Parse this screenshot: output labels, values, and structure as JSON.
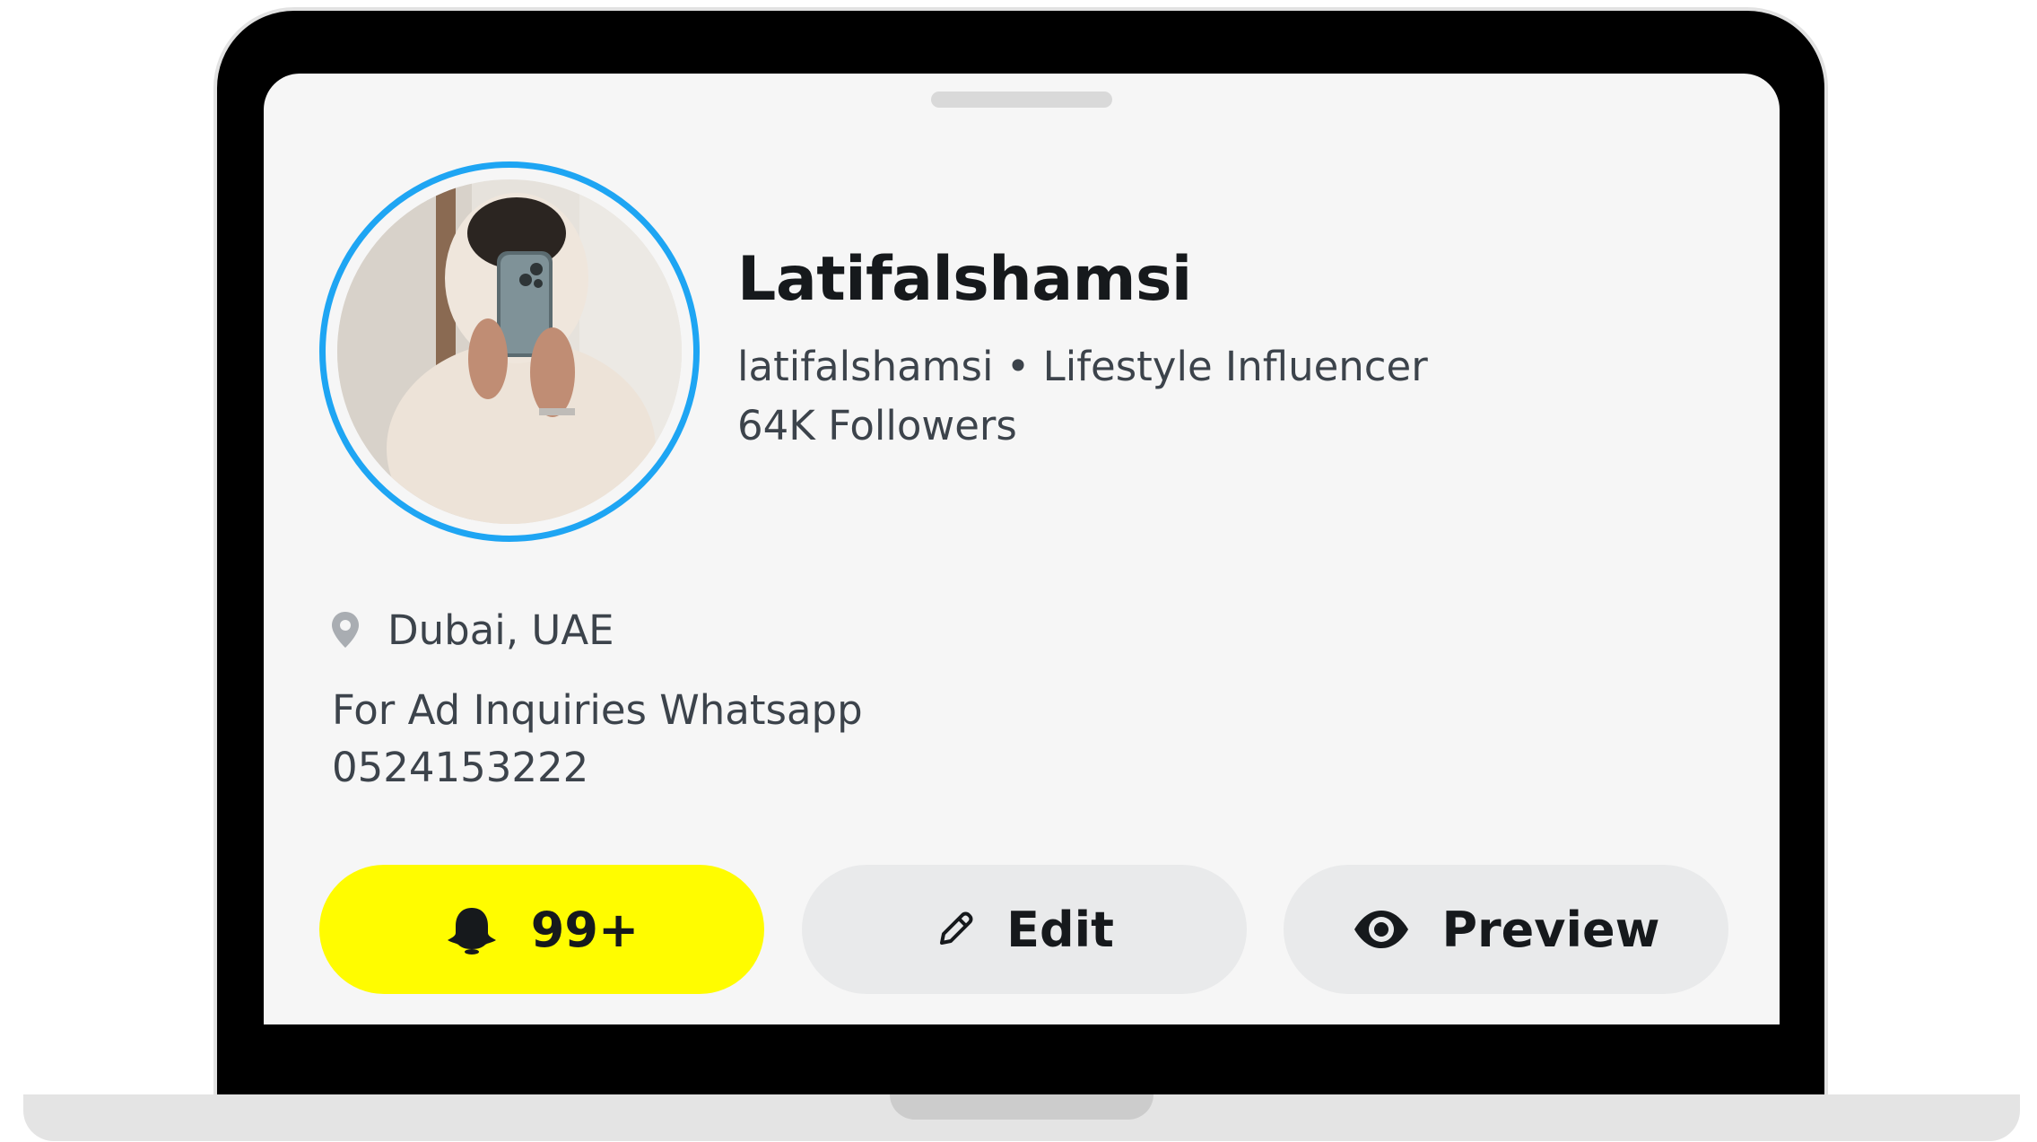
{
  "profile": {
    "display_name": "Latifalshamsi",
    "subtitle": "latifalshamsi • Lifestyle Influencer",
    "followers": "64K Followers",
    "location": "Dubai, UAE",
    "bio_line1": "For Ad Inquiries Whatsapp",
    "bio_line2": "0524153222",
    "avatar_ring_color": "#1ea5f3"
  },
  "actions": {
    "notifications_label": "99+",
    "edit_label": "Edit",
    "preview_label": "Preview",
    "notifications_color": "#fffc00"
  },
  "icons": {
    "location": "map-pin-icon",
    "notifications": "ghost-bell-icon",
    "edit": "pencil-icon",
    "preview": "eye-icon"
  }
}
